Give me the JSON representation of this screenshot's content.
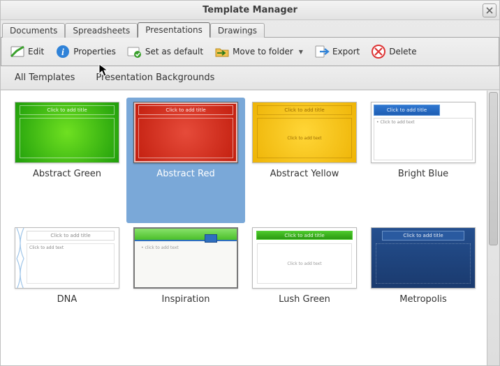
{
  "window": {
    "title": "Template Manager"
  },
  "tabs": [
    "Documents",
    "Spreadsheets",
    "Presentations",
    "Drawings"
  ],
  "active_tab_index": 2,
  "toolbar": {
    "edit": "Edit",
    "properties": "Properties",
    "set_default": "Set as default",
    "move_to_folder": "Move to folder",
    "export": "Export",
    "delete": "Delete"
  },
  "breadcrumb": {
    "root": "All Templates",
    "folder": "Presentation Backgrounds"
  },
  "templates": [
    {
      "id": "abstract-green",
      "label": "Abstract Green",
      "thumb_title": "Click to add title",
      "thumb_body": ""
    },
    {
      "id": "abstract-red",
      "label": "Abstract Red",
      "selected": true,
      "thumb_title": "Click to add title",
      "thumb_body": ""
    },
    {
      "id": "abstract-yellow",
      "label": "Abstract Yellow",
      "thumb_title": "Click to add title",
      "thumb_body": "Click to add text"
    },
    {
      "id": "bright-blue",
      "label": "Bright Blue",
      "thumb_title": "Click to add title",
      "thumb_body": "• Click to add text"
    },
    {
      "id": "dna",
      "label": "DNA",
      "thumb_title": "Click to add title",
      "thumb_body": "Click to add text"
    },
    {
      "id": "inspiration",
      "label": "Inspiration",
      "thumb_title": "",
      "thumb_body": "• click to add text"
    },
    {
      "id": "lush",
      "label": "Lush Green",
      "thumb_title": "Click to add title",
      "thumb_body": "Click to add text"
    },
    {
      "id": "metro",
      "label": "Metropolis",
      "thumb_title": "Click to add title",
      "thumb_body": ""
    }
  ]
}
